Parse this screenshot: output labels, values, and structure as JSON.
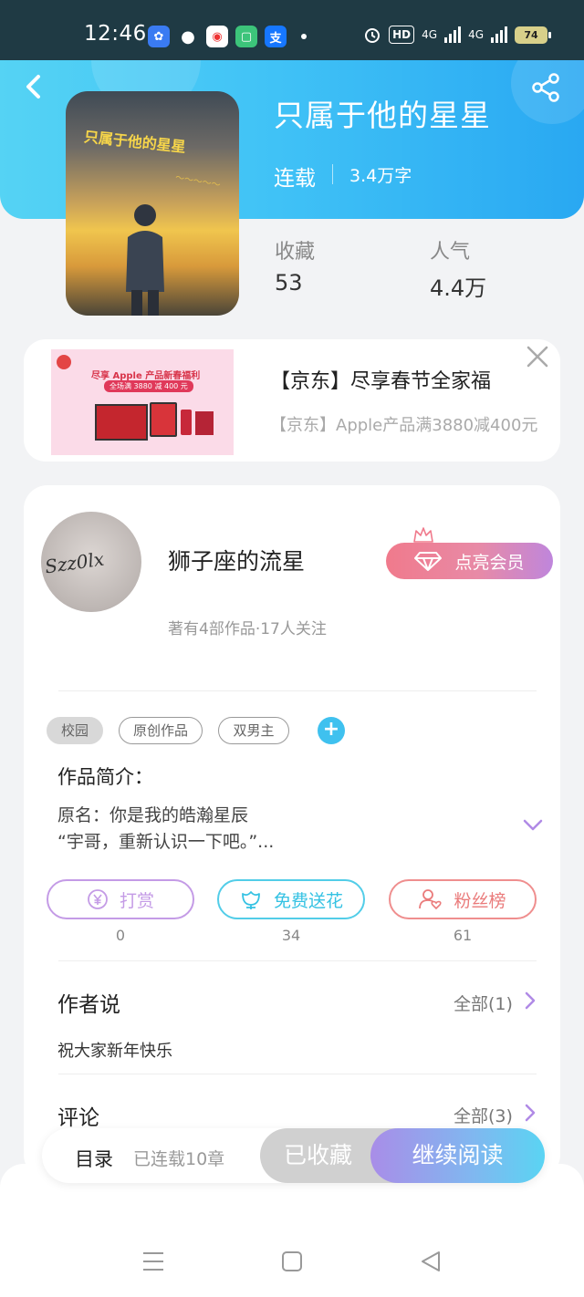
{
  "status_bar": {
    "time": "12:46",
    "apps": [
      "baidu-icon",
      "wechat-icon",
      "map-icon",
      "message-icon",
      "alipay-icon"
    ],
    "hd": "HD",
    "net1": "4G",
    "net2": "4G",
    "battery": "74"
  },
  "book": {
    "title": "只属于他的星星",
    "status": "连载",
    "word_count": "3.4万字",
    "cover_title": "只属于他的星星",
    "collect_label": "收藏",
    "collect_value": "53",
    "popularity_label": "人气",
    "popularity_value": "4.4万"
  },
  "ad": {
    "title": "【京东】尽享春节全家福",
    "desc": "【京东】Apple产品满3880减400元",
    "image_headline": "尽享 Apple 产品新春福利",
    "image_badge": "全场满 3880 减 400 元"
  },
  "author": {
    "name": "狮子座的流星",
    "avatar_text": "Szz0lx",
    "meta": "著有4部作品·17人关注",
    "vip_label": "点亮会员"
  },
  "tags": [
    "校园",
    "原创作品",
    "双男主"
  ],
  "intro": {
    "title": "作品简介：",
    "line1": "原名：你是我的皓瀚星辰",
    "line2": "“宇哥，重新认识一下吧。”..."
  },
  "actions": [
    {
      "label": "打赏",
      "count": "0",
      "color": "#c49be6"
    },
    {
      "label": "免费送花",
      "count": "34",
      "color": "#52cde8"
    },
    {
      "label": "粉丝榜",
      "count": "61",
      "color": "#ef8e8e"
    }
  ],
  "author_says": {
    "title": "作者说",
    "more": "全部(1)",
    "content": "祝大家新年快乐"
  },
  "comments": {
    "title": "评论",
    "more": "全部(3)"
  },
  "bottom_bar": {
    "catalog": "目录",
    "chapters": "已连载10章",
    "collected": "已收藏",
    "continue": "继续阅读"
  },
  "colors": {
    "header_start": "#55d3f4",
    "header_end": "#29a8f2",
    "accent_purple": "#b08ae6",
    "accent_cyan": "#3fc1ef"
  }
}
